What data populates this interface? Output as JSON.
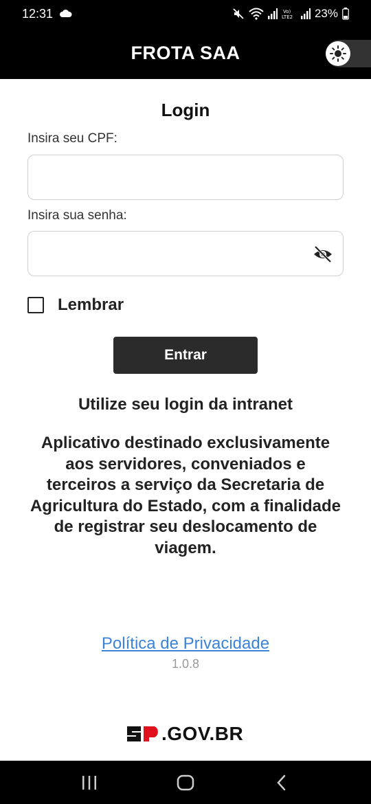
{
  "status_bar": {
    "time": "12:31",
    "battery": "23%",
    "icons": [
      "cloud-icon",
      "mute-icon",
      "wifi-icon",
      "signal-icon",
      "volte-icon",
      "battery-icon"
    ]
  },
  "app_bar": {
    "title": "FROTA SAA",
    "theme_toggle_icon": "sun-icon"
  },
  "login": {
    "title": "Login",
    "cpf_label": "Insira seu CPF:",
    "cpf_value": "",
    "password_label": "Insira sua senha:",
    "password_value": "",
    "password_toggle_icon": "eye-off-icon",
    "remember_label": "Lembrar",
    "remember_checked": false,
    "submit_label": "Entrar"
  },
  "info": {
    "hint": "Utilize seu login da intranet",
    "description_lines": [
      "Aplicativo destinado exclusivamente",
      "aos servidores, conveniados e",
      "terceiros a serviço da Secretaria de",
      "Agricultura do Estado, com a finalidade",
      "de registrar seu deslocamento de",
      "viagem."
    ]
  },
  "footer": {
    "privacy_link": "Política de Privacidade",
    "version": "1.0.8",
    "brand": "SP.GOV.BR",
    "brand_suffix": ".GOV.BR"
  },
  "nav_bar": {
    "items": [
      "recent-apps-icon",
      "home-icon",
      "back-icon"
    ]
  },
  "colors": {
    "header_bg": "#000000",
    "button_bg": "#2b2b2b",
    "link": "#3b83d8",
    "version": "#999999"
  }
}
